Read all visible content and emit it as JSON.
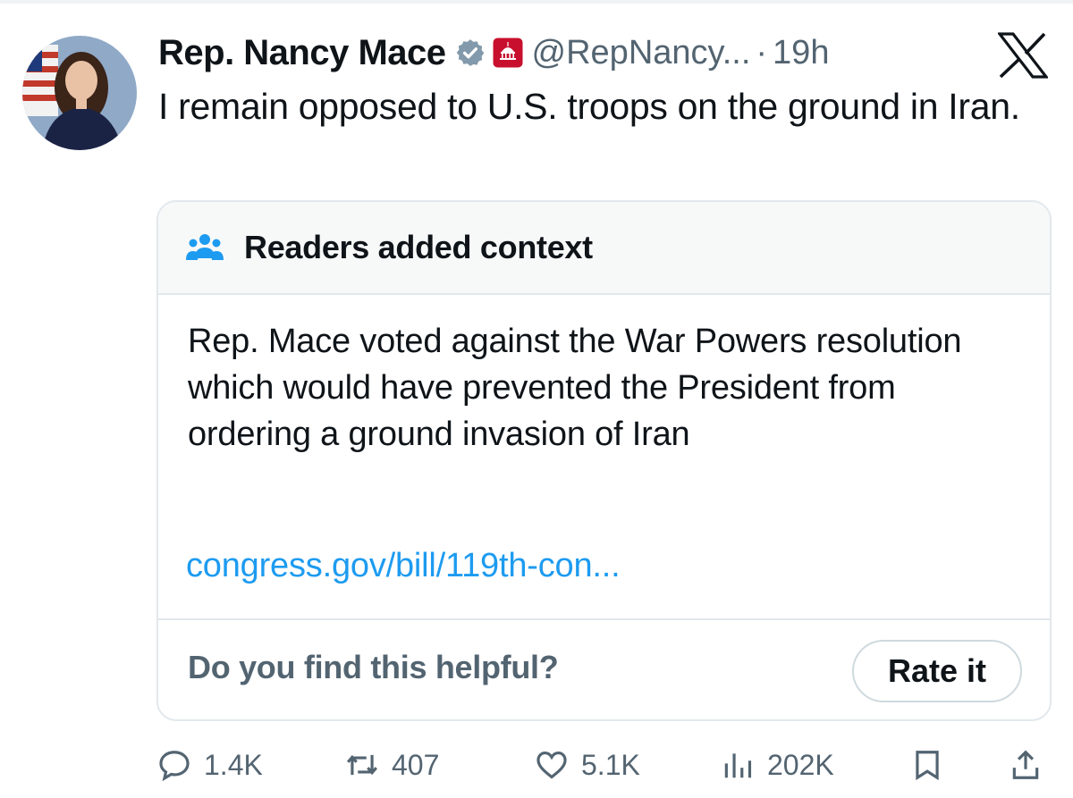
{
  "tweet": {
    "author_name": "Rep. Nancy Mace",
    "handle": "@RepNancy...",
    "separator": "·",
    "time": "19h",
    "text": "I remain opposed to U.S. troops on the ground in Iran."
  },
  "community_note": {
    "title": "Readers added context",
    "body": "Rep. Mace voted against the War Powers resolution which would have prevented the President from ordering a ground invasion of Iran",
    "link_text": "congress.gov/bill/119th-con...",
    "helpful_prompt": "Do you find this helpful?",
    "rate_label": "Rate it"
  },
  "actions": {
    "replies": "1.4K",
    "reposts": "407",
    "likes": "5.1K",
    "views": "202K"
  },
  "colors": {
    "text": "#0f1419",
    "muted": "#536471",
    "link": "#1d9bf0",
    "border": "#e1e8ed",
    "note_header_bg": "#f7f9f9",
    "gop_red": "#c8102e"
  },
  "icons": {
    "brand": "x-logo-icon",
    "verified": "verified-badge-icon",
    "affiliation": "house-gop-badge-icon",
    "note": "people-icon",
    "reply": "reply-icon",
    "repost": "repost-icon",
    "like": "heart-icon",
    "views": "views-icon",
    "bookmark": "bookmark-icon",
    "share": "share-icon"
  }
}
